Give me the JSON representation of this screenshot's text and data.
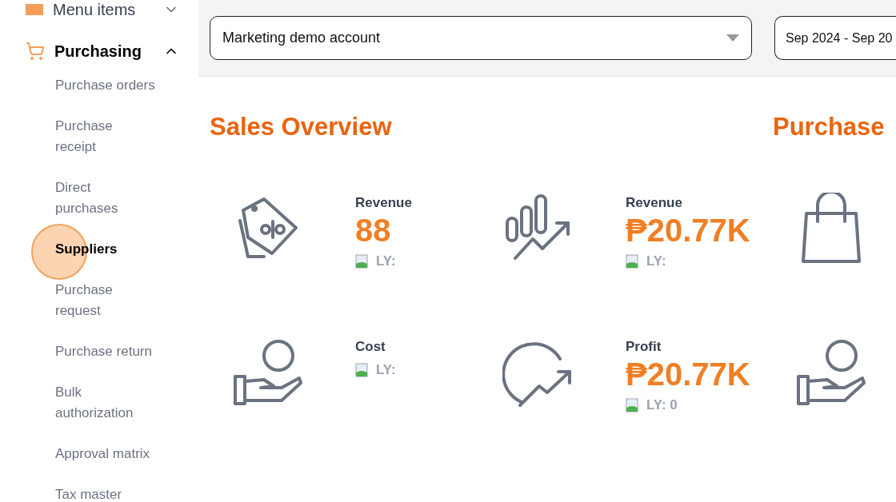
{
  "sidebar": {
    "groups": [
      {
        "label": "Menu items",
        "expanded": false,
        "kind": "menu"
      },
      {
        "label": "Purchasing",
        "expanded": true,
        "kind": "cart",
        "items": [
          {
            "label": "Purchase orders",
            "selected": false
          },
          {
            "label": "Purchase receipt",
            "selected": false
          },
          {
            "label": "Direct purchases",
            "selected": false
          },
          {
            "label": "Suppliers",
            "selected": true
          },
          {
            "label": "Purchase request",
            "selected": false
          },
          {
            "label": "Purchase return",
            "selected": false
          },
          {
            "label": "Bulk authorization",
            "selected": false
          },
          {
            "label": "Approval matrix",
            "selected": false
          },
          {
            "label": "Tax master",
            "selected": false
          }
        ]
      }
    ]
  },
  "toolbar": {
    "account": "Marketing demo account",
    "date_range": "Sep 2024 - Sep 20"
  },
  "sections": [
    {
      "title": "Sales Overview",
      "cards": [
        {
          "kind": "tag",
          "label": "Revenue",
          "value": "88",
          "ly": "LY:"
        },
        {
          "kind": "chart",
          "label": "Revenue",
          "value": "₱20.77K",
          "ly": "LY:"
        },
        {
          "kind": "hand",
          "label": "Cost",
          "ly": "LY:"
        },
        {
          "kind": "circle-arrow",
          "label": "Profit",
          "value": "₱20.77K",
          "ly": "LY: 0"
        }
      ]
    },
    {
      "title": "Purchase",
      "cards": [
        {
          "kind": "bag"
        },
        {
          "kind": "hand"
        }
      ]
    }
  ]
}
